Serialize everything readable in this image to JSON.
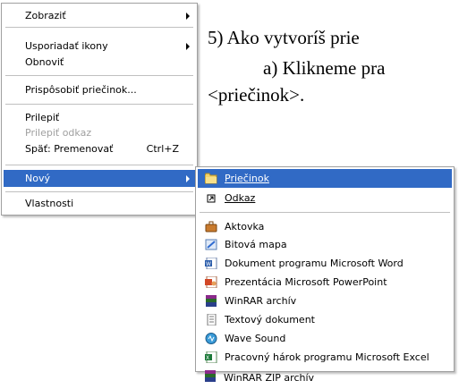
{
  "document": {
    "line1": "5) Ako vytvoríš prie",
    "line2": "a)  Klikneme pra",
    "line3": "<priečinok>."
  },
  "context_menu": {
    "items": [
      {
        "label": "Zobraziť",
        "submenu": true
      },
      {
        "label": "Usporiadať ikony",
        "submenu": true
      },
      {
        "label": "Obnoviť"
      },
      {
        "label": "Prispôsobiť priečinok..."
      },
      {
        "label": "Prilepiť"
      },
      {
        "label": "Prilepiť odkaz",
        "disabled": true
      },
      {
        "label": "Späť: Premenovať",
        "shortcut": "Ctrl+Z"
      },
      {
        "label": "Nový",
        "submenu": true,
        "highlighted": true
      },
      {
        "label": "Vlastnosti"
      }
    ]
  },
  "submenu": {
    "items": [
      {
        "label": "Priečinok",
        "icon": "folder-icon",
        "highlighted": true
      },
      {
        "label": "Odkaz",
        "icon": "shortcut-icon"
      },
      {
        "label": "Aktovka",
        "icon": "briefcase-icon"
      },
      {
        "label": "Bitová mapa",
        "icon": "bitmap-icon"
      },
      {
        "label": "Dokument programu Microsoft Word",
        "icon": "word-document-icon"
      },
      {
        "label": "Prezentácia Microsoft PowerPoint",
        "icon": "powerpoint-icon"
      },
      {
        "label": "WinRAR archív",
        "icon": "winrar-icon"
      },
      {
        "label": "Textový dokument",
        "icon": "text-document-icon"
      },
      {
        "label": "Wave Sound",
        "icon": "wave-sound-icon"
      },
      {
        "label": "Pracovný hárok programu Microsoft Excel",
        "icon": "excel-icon"
      },
      {
        "label": "WinRAR ZIP archív",
        "icon": "winrar-zip-icon"
      }
    ]
  },
  "colors": {
    "highlight": "#316ac5",
    "disabled": "#a0a0a0"
  }
}
